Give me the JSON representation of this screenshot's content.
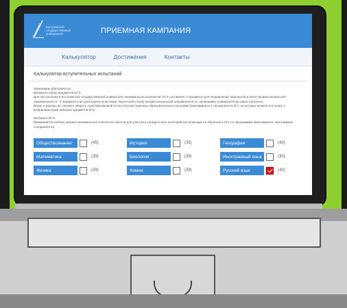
{
  "header": {
    "logo_text": "Костромской государственный университет",
    "title": "ПРИЕМНАЯ КАМПАНИЯ"
  },
  "nav": [
    "Калькулятор",
    "Достижения",
    "Контакты"
  ],
  "page_title": "Калькулятор вступительных испытаний",
  "intro": {
    "greeting": "Уважаемые абитуриенты!",
    "line1": "Выберите набор предметов ЕГЭ:",
    "line2": "Для поступления в Костромской государственный университет минимальное количество ЕГЭ составляет 3 предмета; для направлений творческой и (или) профессиональной направленности - 2 предмета и вступительное испытание творческой и (или) профессиональной направленности, проводимое университетом самостоятельно.",
    "line3": "Внизу страницы вы сможете увидеть сгруппированный по институтам перечень образовательных программ бакалавриата и специалитета КГУ, на которые можете поступать с выбранным вами набором предметов ЕГЭ.",
    "choose": "Выберите ЕГЭ:",
    "note": "(Внимание! В скобках указано минимальное количество баллов для участия в конкурсе всех категорий поступающих на обучение в КГУ по программам бакалавриата, программам специалитета)"
  },
  "subjects": [
    [
      {
        "name": "Обществознание",
        "score": "(45)",
        "checked": false
      },
      {
        "name": "История",
        "score": "(35)",
        "checked": false
      },
      {
        "name": "География",
        "score": "(40)",
        "checked": false
      }
    ],
    [
      {
        "name": "Математика",
        "score": "(39)",
        "checked": false
      },
      {
        "name": "Биология",
        "score": "(39)",
        "checked": false
      },
      {
        "name": "Иностранный язык",
        "score": "(30)",
        "checked": false
      }
    ],
    [
      {
        "name": "Физика",
        "score": "(39)",
        "checked": false
      },
      {
        "name": "Химия",
        "score": "(39)",
        "checked": false
      },
      {
        "name": "Русский язык",
        "score": "(40)",
        "checked": true
      }
    ]
  ],
  "colors": {
    "accent": "#3a8ad6",
    "background": "#8fcf2f",
    "checked": "#e01010"
  }
}
